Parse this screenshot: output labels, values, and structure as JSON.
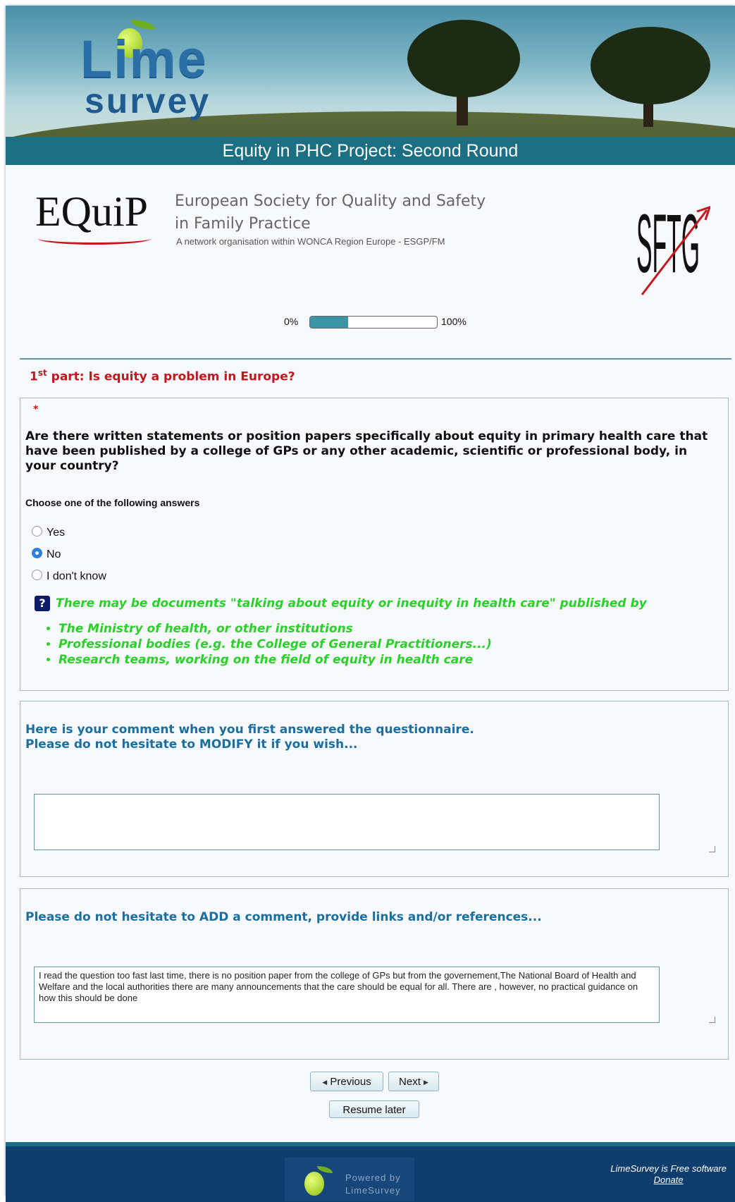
{
  "header": {
    "logo_top": "Lime",
    "logo_bottom": "survey",
    "survey_title": "Equity in PHC Project: Second Round"
  },
  "org": {
    "equip_logo": "EQuiP",
    "title_line1": "European Society for Quality and Safety",
    "title_line2": "in Family Practice",
    "subtitle": "A network organisation within WONCA Region Europe - ESGP/FM",
    "sftg_logo": "SFTG"
  },
  "progress": {
    "min_label": "0%",
    "max_label": "100%",
    "value_percent": 30
  },
  "group": {
    "ordinal": "1",
    "suffix": "st",
    "title": " part: Is equity a problem in Europe?"
  },
  "question1": {
    "mandatory_mark": "*",
    "text": "Are there written statements or position papers specifically about equity in primary health care that have been published by a college of GPs or any other academic, scientific or professional body, in your country?",
    "hint": "Choose one of the following answers",
    "options": [
      {
        "label": "Yes",
        "selected": false
      },
      {
        "label": "No",
        "selected": true
      },
      {
        "label": "I don't know",
        "selected": false
      }
    ],
    "help_icon": "question-mark-icon",
    "help_text": "There may be documents \"talking about equity or inequity in health care\" published by",
    "help_items": [
      "The Ministry of health, or other institutions",
      "Professional bodies (e.g. the College of General Practitioners...)",
      "Research teams, working on the field of equity in health care"
    ]
  },
  "question2": {
    "line1": "Here is your comment when you first answered the questionnaire.",
    "line2": "Please do not hesitate to MODIFY it if you wish...",
    "value": ""
  },
  "question3": {
    "text": "Please do not hesitate to ADD a comment, provide links and/or references...",
    "value": "I read the question too fast last time, there is no position paper from the college of GPs but  from the governement,The National Board of Health and Welfare and the local authorities there are many announcements that the care should be equal for all. There are , however, no practical guidance on how this should be done"
  },
  "nav": {
    "previous": "Previous",
    "next": "Next",
    "resume": "Resume later"
  },
  "footer": {
    "powered_line1": "Powered by",
    "powered_line2": "LimeSurvey",
    "free_text": "LimeSurvey is Free software",
    "donate": "Donate"
  },
  "colors": {
    "title_bar": "#1c6e83",
    "group_title": "#c0161e",
    "help_text": "#2bd02b",
    "comment_text": "#1a6ea0",
    "footer": "#0f3d6e"
  }
}
